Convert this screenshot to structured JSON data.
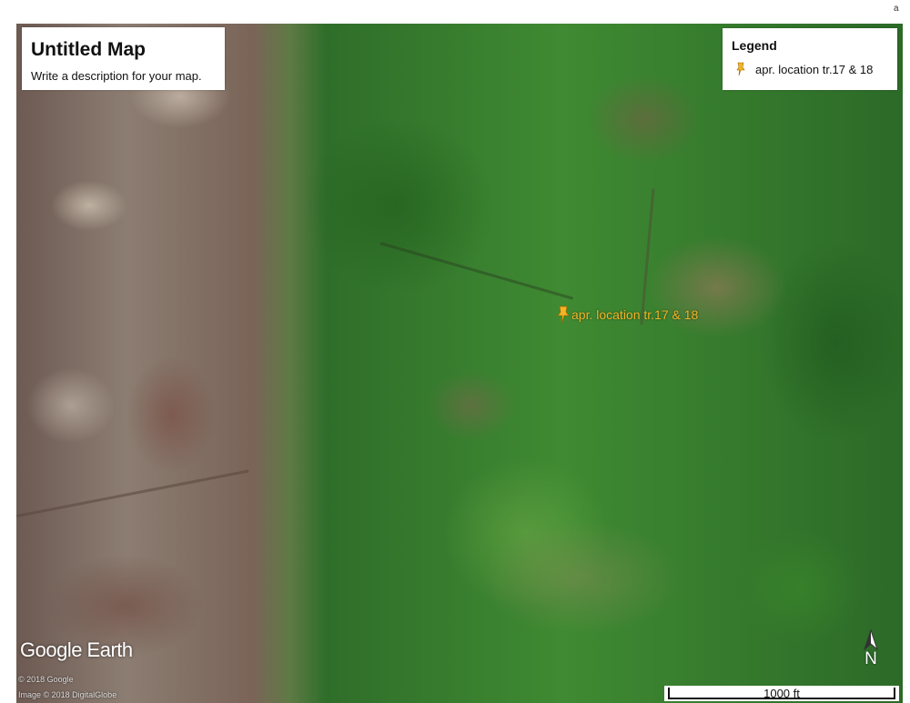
{
  "map": {
    "title": "Untitled Map",
    "description": "Write a description for your map."
  },
  "legend": {
    "title": "Legend",
    "items": [
      {
        "label": "apr. location tr.17 & 18",
        "icon": "yellow-pushpin-icon",
        "color": "#f4b426"
      }
    ]
  },
  "placemarks": [
    {
      "label": "apr. location tr.17 & 18",
      "icon": "yellow-pushpin-icon",
      "color": "#f4b426"
    }
  ],
  "branding": {
    "logo": "Google Earth",
    "copyright_1": "© 2018 Google",
    "copyright_2": "Image © 2018 DigitalGlobe"
  },
  "compass": {
    "label": "N",
    "icon": "north-arrow-icon"
  },
  "scale_bar": {
    "label": "1000 ft"
  },
  "corner_mark": "a"
}
